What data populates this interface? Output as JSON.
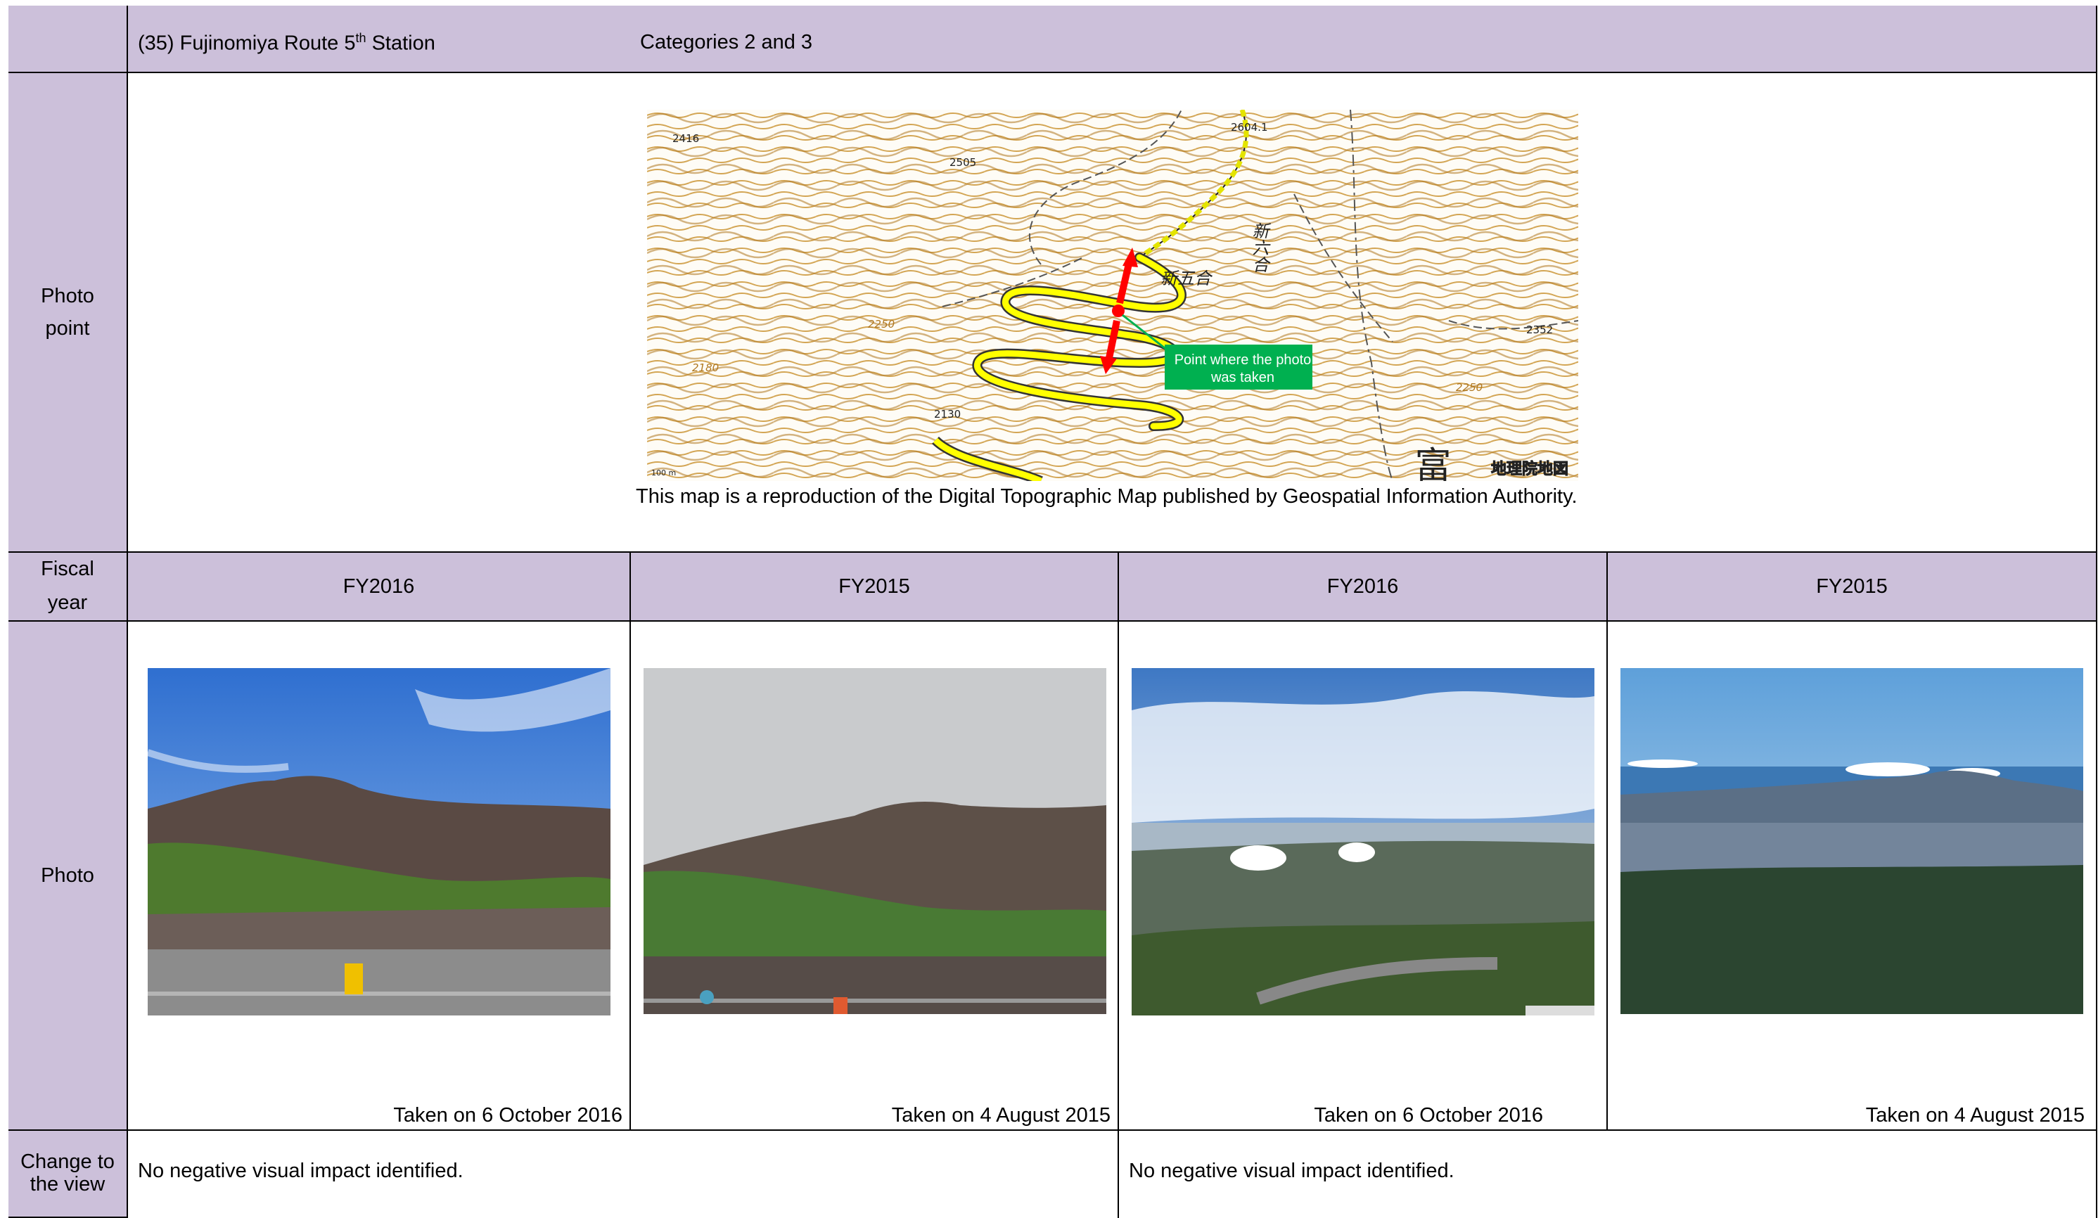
{
  "header": {
    "station_number": "(35)",
    "station_name": "Fujinomiya Route 5",
    "station_sup": "th",
    "station_suffix": "Station",
    "categories": "Categories 2 and 3"
  },
  "rows": {
    "photo_point_label": "Photo point",
    "fiscal_year_label": "Fiscal year",
    "photo_label": "Photo",
    "change_label": "Change to the view"
  },
  "map": {
    "callout": "Point where the photo was taken",
    "caption": "This map is a reproduction of the Digital Topographic Map published by Geospatial Information Authority.",
    "labels": {
      "new5": "新五合",
      "new6": "新六合",
      "fuji": "富士",
      "gsi": "地理院地図",
      "e2416": "2416",
      "e2505": "2505",
      "e2604": "2604.1",
      "e2250a": "2250",
      "e2180": "2180",
      "e2130": "2130",
      "e2352": "2352",
      "e2250b": "2250",
      "scale": "100 m"
    }
  },
  "columns": [
    {
      "fiscal_year": "FY2016",
      "taken": "Taken on 6 October 2016"
    },
    {
      "fiscal_year": "FY2015",
      "taken": "Taken on 4 August 2015"
    },
    {
      "fiscal_year": "FY2016",
      "taken": "Taken on 6 October 2016"
    },
    {
      "fiscal_year": "FY2015",
      "taken": "Taken on 4 August 2015"
    }
  ],
  "change": [
    "No negative visual impact identified.",
    "No negative visual impact identified."
  ],
  "colors": {
    "header_bg": "#ccc0da",
    "callout_bg": "#00b050",
    "arrow": "#ff0000",
    "route_yellow": "#ffff00",
    "contour": "#c8902a"
  }
}
